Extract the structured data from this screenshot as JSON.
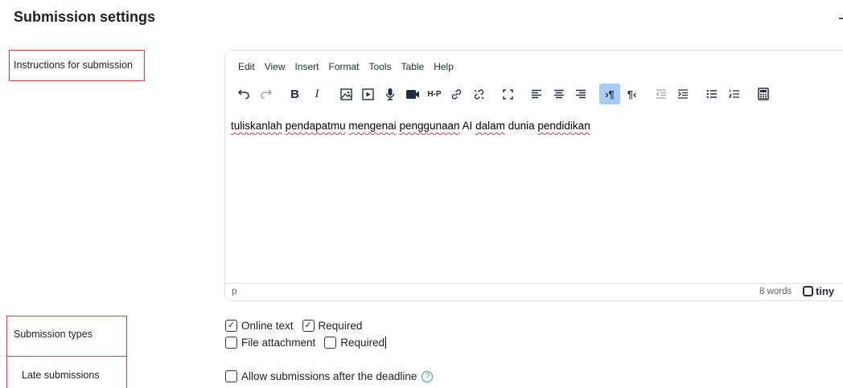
{
  "section": {
    "title": "Submission settings"
  },
  "instructions": {
    "label": "Instructions for submission",
    "editor": {
      "menu": [
        "Edit",
        "View",
        "Insert",
        "Format",
        "Tools",
        "Table",
        "Help"
      ],
      "toolbar_icons": [
        "undo-icon",
        "redo-icon",
        "bold-icon",
        "italic-icon",
        "image-icon",
        "media-icon",
        "record-audio-icon",
        "record-video-icon",
        "h5p-icon",
        "link-icon",
        "unlink-icon",
        "fullscreen-icon",
        "align-left-icon",
        "align-center-icon",
        "align-right-icon",
        "ltr-icon",
        "rtl-icon",
        "outdent-icon",
        "indent-icon",
        "bullet-list-icon",
        "numbered-list-icon",
        "equation-editor-icon"
      ],
      "text_parts": [
        "tuliskanlah",
        " ",
        "pendapatmu",
        " ",
        "mengenai",
        " ",
        "penggunaan",
        " AI ",
        "dalam",
        " dunia ",
        "pendidikan"
      ],
      "status_path": "p",
      "word_count": "8 words",
      "brand": "tiny"
    }
  },
  "submission_types": {
    "label": "Submission types",
    "online_text": {
      "label": "Online text",
      "checked": true
    },
    "online_text_required": {
      "label": "Required",
      "checked": true
    },
    "file_attachment": {
      "label": "File attachment",
      "checked": false
    },
    "file_attachment_required": {
      "label": "Required",
      "checked": false
    }
  },
  "late": {
    "label": "Late submissions",
    "allow": {
      "label": "Allow submissions after the deadline",
      "checked": false
    },
    "help_glyph": "?"
  },
  "colors": {
    "highlight_border": "#e0393e",
    "active_button": "#a6ccf7",
    "help_icon": "#3e8acc"
  }
}
